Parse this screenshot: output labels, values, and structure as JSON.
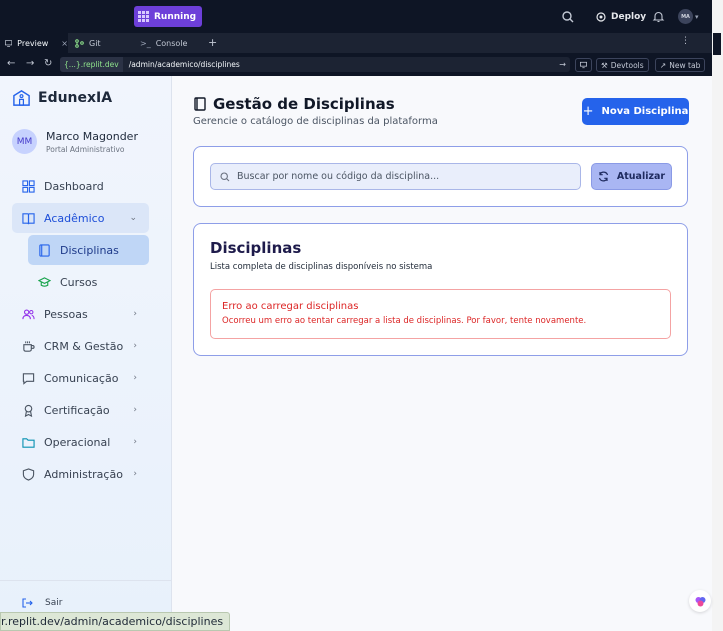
{
  "replit": {
    "run_status": "Running",
    "deploy_label": "Deploy",
    "user_initials": "MA",
    "tabs": [
      {
        "label": "Preview"
      },
      {
        "label": "Git"
      },
      {
        "label": "Console"
      }
    ],
    "url_host": "{...}.replit.dev",
    "url_path": "/admin/academico/disciplines",
    "devtools_label": "Devtools",
    "newtab_label": "New tab",
    "status_url": "r.replit.dev/admin/academico/disciplines"
  },
  "sidebar": {
    "brand": "EdunexIA",
    "user": {
      "initials": "MM",
      "name": "Marco Magonder",
      "role": "Portal Administrativo"
    },
    "items": [
      {
        "label": "Dashboard",
        "icon": "grid-icon"
      },
      {
        "label": "Acadêmico",
        "icon": "book-open-icon"
      },
      {
        "label": "Disciplinas",
        "icon": "book-icon"
      },
      {
        "label": "Cursos",
        "icon": "graduation-cap-icon"
      },
      {
        "label": "Pessoas",
        "icon": "users-icon"
      },
      {
        "label": "CRM & Gestão",
        "icon": "coffee-icon"
      },
      {
        "label": "Comunicação",
        "icon": "message-icon"
      },
      {
        "label": "Certificação",
        "icon": "award-icon"
      },
      {
        "label": "Operacional",
        "icon": "folder-icon"
      },
      {
        "label": "Administração",
        "icon": "shield-icon"
      }
    ],
    "logout_label": "Sair"
  },
  "main": {
    "title": "Gestão de Disciplinas",
    "subtitle": "Gerencie o catálogo de disciplinas da plataforma",
    "new_button": "Nova Disciplina",
    "search_placeholder": "Buscar por nome ou código da disciplina...",
    "refresh_button": "Atualizar",
    "list_title": "Disciplinas",
    "list_subtitle": "Lista completa de disciplinas disponíveis no sistema",
    "error_title": "Erro ao carregar disciplinas",
    "error_message": "Ocorreu um erro ao tentar carregar a lista de disciplinas. Por favor, tente novamente."
  },
  "colors": {
    "primary": "#2563eb",
    "error": "#dc2626",
    "replit_bg": "#0e1525",
    "running": "#6d3fd9"
  }
}
